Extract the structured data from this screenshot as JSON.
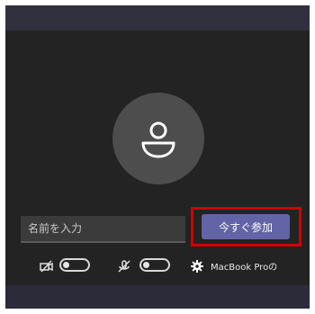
{
  "name_field": {
    "placeholder": "名前を入力",
    "value": ""
  },
  "join_button": {
    "label": "今すぐ参加",
    "color": "#6264a7"
  },
  "controls": {
    "video_toggle": "off",
    "audio_toggle": "off",
    "device_label": "MacBook Proの"
  },
  "icons": {
    "avatar": "person-icon",
    "camera": "camera-off-icon",
    "microphone": "mic-off-icon",
    "settings": "gear-icon"
  },
  "colors": {
    "panel": "#232323",
    "highlight": "#d00000"
  }
}
